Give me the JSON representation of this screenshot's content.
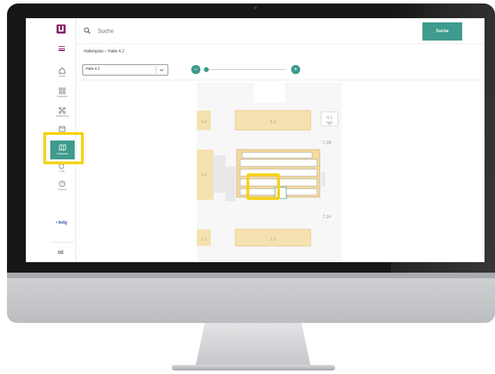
{
  "app": {
    "brand_color": "#8b2a6b",
    "accent_color": "#3e9b8d",
    "highlight_color": "#f5d315"
  },
  "search": {
    "placeholder": "Suche",
    "button_label": "Suche"
  },
  "breadcrumb": {
    "root": "Hallenplan",
    "separator": "›",
    "current": "Halle 4.2"
  },
  "hall_select": {
    "value": "Halle 4.2"
  },
  "sidebar": {
    "items": [
      {
        "label": "Home",
        "icon": "home-icon"
      },
      {
        "label": "Aussteller",
        "icon": "grid-icon"
      },
      {
        "label": "Networking",
        "icon": "networking-icon"
      },
      {
        "label": "",
        "icon": "calendar-icon"
      },
      {
        "label": "Hallenplan",
        "icon": "map-icon"
      },
      {
        "label": "Café",
        "icon": "cup-icon"
      },
      {
        "label": "Support",
        "icon": "help-icon"
      }
    ],
    "brand_logo": "• bvlg",
    "language": "DE"
  },
  "map": {
    "labels": [
      "5.2",
      "6.2",
      "4.1",
      "7.2B",
      "3.2",
      "7.2A",
      "1.2",
      "2.2"
    ]
  }
}
